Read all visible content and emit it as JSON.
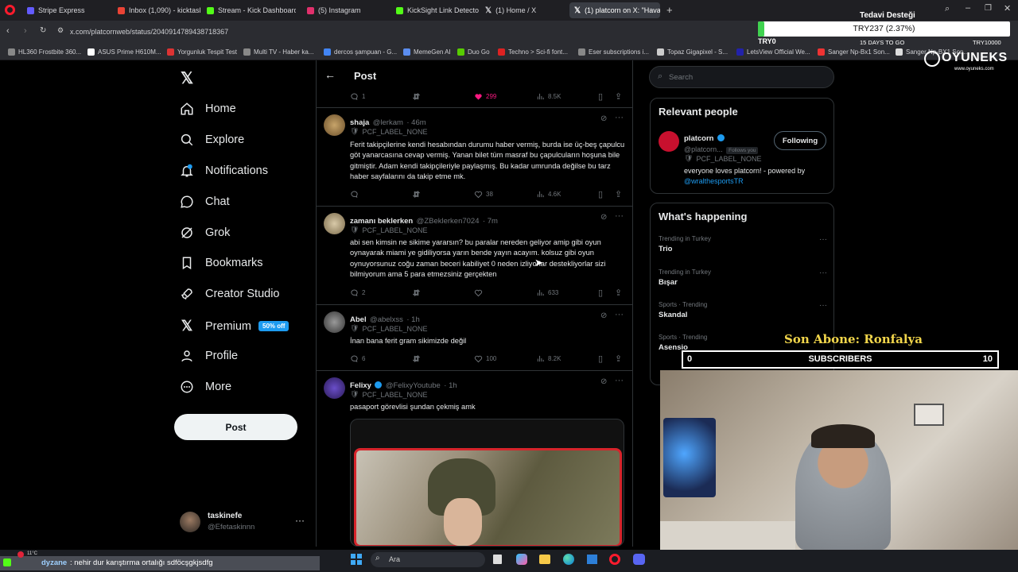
{
  "browser": {
    "tabs": [
      {
        "label": "Stripe Express",
        "color": "#635bff"
      },
      {
        "label": "Inbox (1,090) - kicktaskin",
        "color": "#ea4335"
      },
      {
        "label": "Stream - Kick Dashboard",
        "color": "#53fc18"
      },
      {
        "label": "(5) Instagram",
        "color": "#e1306c"
      },
      {
        "label": "KickSight Link Detector",
        "color": "#53fc18"
      },
      {
        "label": "(1) Home / X",
        "color": "#ffffff"
      },
      {
        "label": "(1) platcorn on X: \"Havaal",
        "color": "#ffffff"
      }
    ],
    "url": "x.com/platcornweb/status/2040914789438718367",
    "bookmarks": [
      "HL360 Frostbite 360...",
      "ASUS Prime H610M...",
      "Yorgunluk Tespit Test",
      "Multi TV - Haber ka...",
      "dercos şampuan - G...",
      "MemeGen AI",
      "Duo Go",
      "Techno > Sci-fi font...",
      "Eser subscriptions i...",
      "Topaz Gigapixel - S...",
      "LetsView Official We...",
      "Sanger Np-Bx1 Son...",
      "Sanger Np-BX1 Son..."
    ]
  },
  "donation": {
    "title": "Tedavi Desteği",
    "amount": "TRY237 (2.37%)",
    "left": "TRY0",
    "days": "15 DAYS TO GO",
    "right": "TRY10000",
    "progress": 0.0237
  },
  "sponsor": {
    "name": "OYUNEKS",
    "url": "www.oyuneks.com"
  },
  "nav": {
    "items": [
      "Home",
      "Explore",
      "Notifications",
      "Chat",
      "Grok",
      "Bookmarks",
      "Creator Studio",
      "Premium",
      "Profile",
      "More"
    ],
    "premium_badge": "50% off",
    "post_button": "Post",
    "account_name": "taskinefe",
    "account_handle": "@Efetaskinnn"
  },
  "header": {
    "title": "Post"
  },
  "top_actions": {
    "replies": "1",
    "likes": "299",
    "views": "8.5K"
  },
  "posts": [
    {
      "name": "shaja",
      "handle": "@lerkam",
      "time": "· 46m",
      "label": "PCF_LABEL_NONE",
      "text": "Ferit takipçilerine kendi hesabından durumu haber vermiş, burda ise üç-beş çapulcu göt yanarcasına cevap vermiş. Yanan bilet tüm masraf bu çapulcuların hoşuna bile gitmiştir. Adam kendi takipçileriyle paylaşmış. Bu kadar umrunda değilse bu tarz haber sayfalarını da takip etme mk.",
      "replies": "",
      "likes": "38",
      "views": "4.6K"
    },
    {
      "name": "zamanı beklerken",
      "handle": "@ZBeklerken7024",
      "time": "· 7m",
      "label": "PCF_LABEL_NONE",
      "text": "abi sen kimsin ne sikime yararsın? bu paralar nereden geliyor amip gibi oyun oynayarak miami ye gidiliyorsa yarın bende yayın acayım. kolsuz gibi oyun oynuyorsunuz coğu zaman beceri kabiliyet 0 neden izliyorlar destekliyorlar sizi bilmiyorum ama 5 para etmezsiniz gerçekten",
      "replies": "2",
      "likes": "",
      "views": "633"
    },
    {
      "name": "Abel",
      "handle": "@abelxss",
      "time": "· 1h",
      "label": "PCF_LABEL_NONE",
      "text": "İnan bana ferit gram sikimizde değil",
      "replies": "6",
      "likes": "100",
      "views": "8.2K"
    },
    {
      "name": "Felixy",
      "handle": "@FelixyYoutube",
      "time": "· 1h",
      "label": "PCF_LABEL_NONE",
      "text": "pasaport görevlisi şundan çekmiş amk"
    }
  ],
  "search": {
    "placeholder": "Search"
  },
  "relevant": {
    "title": "Relevant people",
    "name": "platcorn",
    "handle": "@platcorn...",
    "follows_you": "Follows you",
    "follow_btn": "Following",
    "label": "PCF_LABEL_NONE",
    "bio": "everyone loves platcorn! - powered by",
    "bio_link": "@wralthesportsTR"
  },
  "happening": {
    "title": "What's happening",
    "trends": [
      {
        "context": "Trending in Turkey",
        "name": "Trio"
      },
      {
        "context": "Trending in Turkey",
        "name": "Bışar"
      },
      {
        "context": "Sports · Trending",
        "name": "Skandal"
      },
      {
        "context": "Sports · Trending",
        "name": "Asensio"
      }
    ]
  },
  "stream_overlay": {
    "last_sub": "Son Abone: Ronfalya",
    "sub_left": "0",
    "sub_label": "SUBSCRIBERS",
    "sub_right": "10"
  },
  "chat_ticker": {
    "user": "dyzane",
    "message": ": nehir dur karıştırma ortalığı sdföcşgkjsdfg"
  },
  "taskbar": {
    "search_placeholder": "Ara",
    "weather": "11°C"
  }
}
